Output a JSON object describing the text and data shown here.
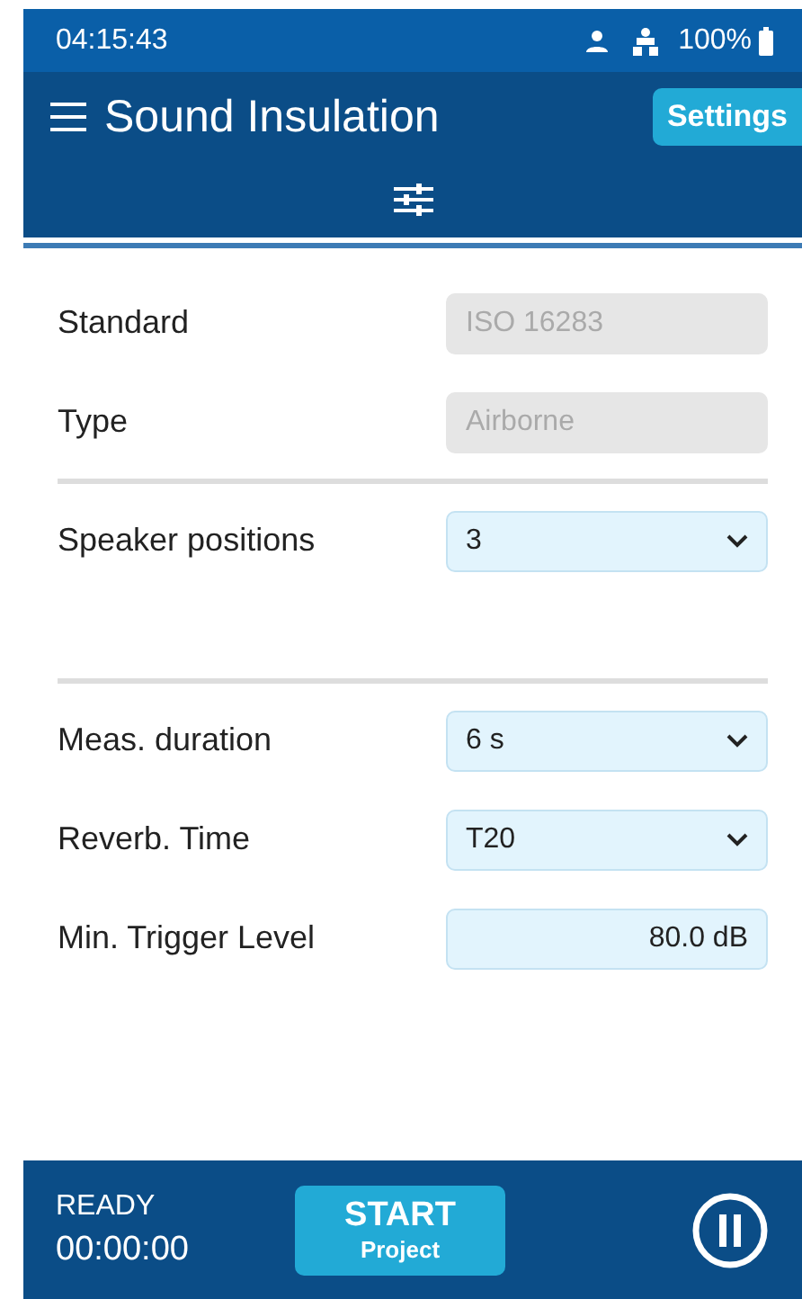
{
  "status_bar": {
    "time": "04:15:43",
    "battery": "100%"
  },
  "header": {
    "title": "Sound Insulation",
    "settings_button": "Settings"
  },
  "groups": [
    {
      "fields": [
        {
          "label": "Standard",
          "kind": "readonly",
          "value": "ISO 16283"
        },
        {
          "label": "Type",
          "kind": "readonly",
          "value": "Airborne"
        }
      ]
    },
    {
      "fields": [
        {
          "label": "Speaker positions",
          "kind": "select",
          "value": "3"
        }
      ]
    },
    {
      "fields": [
        {
          "label": "Meas. duration",
          "kind": "select",
          "value": "6 s"
        },
        {
          "label": "Reverb. Time",
          "kind": "select",
          "value": "T20"
        },
        {
          "label": "Min. Trigger Level",
          "kind": "input",
          "value": "80.0 dB"
        }
      ]
    }
  ],
  "footer": {
    "state": "READY",
    "timer": "00:00:00",
    "start_button": {
      "label": "START",
      "sublabel": "Project"
    }
  }
}
